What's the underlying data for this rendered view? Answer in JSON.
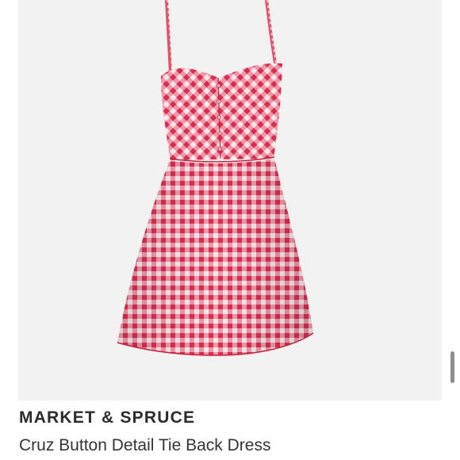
{
  "product": {
    "image_alt": "Red gingham sleeveless dress",
    "brand": "MARKET & SPRUCE",
    "title": "Cruz Button Detail Tie Back Dress"
  },
  "colors": {
    "image_background": "#f2f2f2",
    "gingham_red": "#e0405e",
    "gingham_light": "#fbe3e8",
    "text_dark": "#2b2b2b"
  }
}
